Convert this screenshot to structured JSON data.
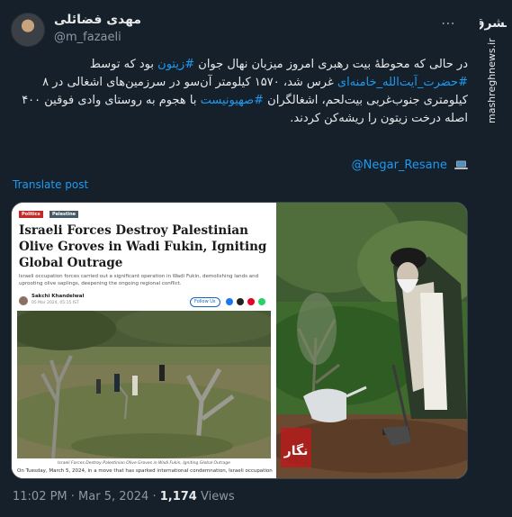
{
  "author": {
    "display_name": "مهدی فضائلی",
    "handle": "@m_fazaeli"
  },
  "tweet": {
    "line1": {
      "pre": "در حالی که محوطهٔ بیت رهبری امروز میزبان نهال جوان ",
      "tag": "#زیتون",
      "post": " بود که توسط"
    },
    "line2": {
      "tag": "#حضرت_آیت‌الله_خامنه‌ای",
      "post": " غرس شد، ۱۵۷۰ کیلومتر آن‌سو در سرزمین‌های اشغالی در ۸"
    },
    "line3": {
      "pre": "کیلومتری جنوب‌غربی بیت‌لحم، اشغالگران ",
      "tag": "#صهیونیست",
      "post": " با هجوم به روستای وادی فوقین ۴۰۰"
    },
    "line4": "اصله درخت زیتون را ریشه‌کن کردند.",
    "mention": "@Negar_Resane",
    "mention_icon": "laptop-icon"
  },
  "translate_label": "Translate post",
  "article": {
    "chips": [
      "Politics",
      "Palestine"
    ],
    "headline": "Israeli Forces Destroy Palestinian Olive Groves in Wadi Fukin, Igniting Global Outrage",
    "subhead": "Israeli occupation forces carried out a significant operation in Wadi Fukin, demolishing lands and uprooting olive saplings, deepening the ongoing regional conflict.",
    "author": "Sakchi Khandelwal",
    "date": "05 Mar 2024, 05:15 IST",
    "follow_label": "Follow Us",
    "caption": "Israeli Forces Destroy Palestinian Olive Groves in Wadi Fukin, Igniting Global Outrage",
    "footer_text": "On Tuesday, March 5, 2024, in a move that has sparked international condemnation, Israeli occupation"
  },
  "watermark_badge": "نگار",
  "footer": {
    "time": "11:02 PM · Mar 5, 2024 · ",
    "views_count": "1,174",
    "views_label": " Views"
  },
  "site": {
    "logo_text": "مشرق",
    "watermark": "mashreghnews.ir"
  },
  "colors": {
    "background": "#15202b",
    "link": "#1d9bf0",
    "text": "#e7e9ea",
    "muted": "#8b98a5"
  }
}
